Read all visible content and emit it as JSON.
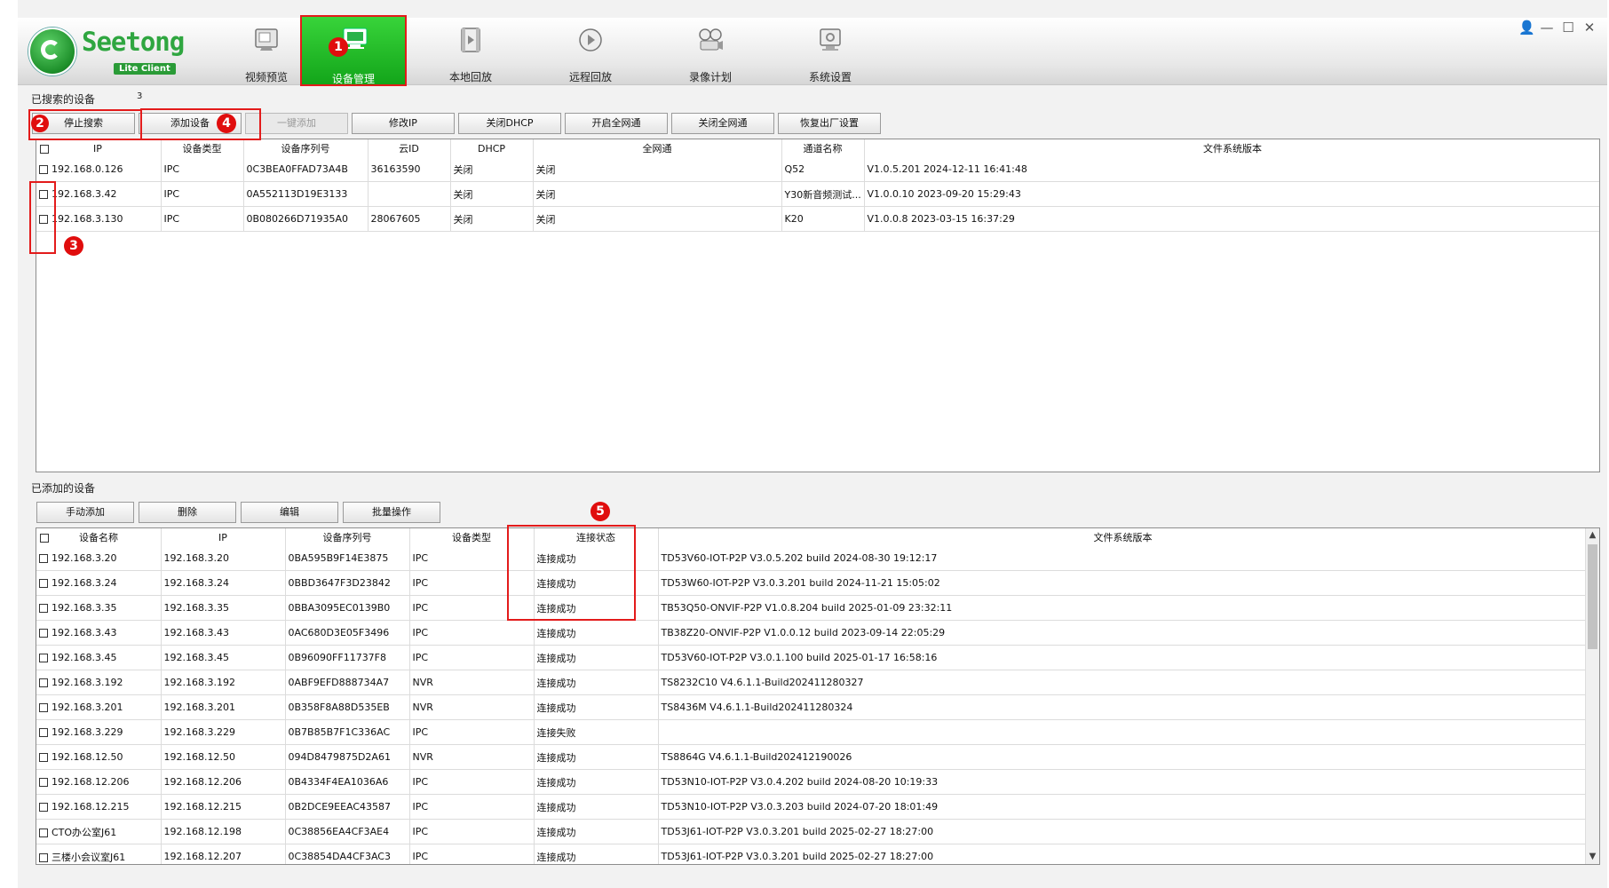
{
  "window": {
    "controls": [
      "👤",
      "—",
      "☐",
      "✕"
    ]
  },
  "logo": {
    "name": "Seetong",
    "subtitle": "Lite Client"
  },
  "nav": {
    "tabs": [
      {
        "label": "视频预览",
        "icon": "video-preview-icon"
      },
      {
        "label": "设备管理",
        "icon": "device-management-icon",
        "active": true
      },
      {
        "label": "本地回放",
        "icon": "local-playback-icon"
      },
      {
        "label": "远程回放",
        "icon": "remote-playback-icon"
      },
      {
        "label": "录像计划",
        "icon": "recording-plan-icon"
      },
      {
        "label": "系统设置",
        "icon": "system-settings-icon"
      }
    ]
  },
  "annotations": [
    "1",
    "2",
    "3",
    "4",
    "5"
  ],
  "searched": {
    "title": "已搜索的设备",
    "count": "3",
    "buttons": [
      "停止搜索",
      "添加设备",
      "一键添加",
      "修改IP",
      "关闭DHCP",
      "开启全网通",
      "关闭全网通",
      "恢复出厂设置"
    ],
    "columns": [
      "IP",
      "设备类型",
      "设备序列号",
      "云ID",
      "DHCP",
      "全网通",
      "通道名称",
      "文件系统版本"
    ],
    "rows": [
      [
        "192.168.0.126",
        "IPC",
        "0C3BEA0FFAD73A4B",
        "36163590",
        "关闭",
        "关闭",
        "Q52",
        "V1.0.5.201 2024-12-11 16:41:48"
      ],
      [
        "192.168.3.42",
        "IPC",
        "0A552113D19E3133",
        "",
        "关闭",
        "关闭",
        "Y30新音频测试...",
        "V1.0.0.10 2023-09-20 15:29:43"
      ],
      [
        "192.168.3.130",
        "IPC",
        "0B080266D71935A0",
        "28067605",
        "关闭",
        "关闭",
        "K20",
        "V1.0.0.8 2023-03-15 16:37:29"
      ]
    ]
  },
  "added": {
    "title": "已添加的设备",
    "buttons": [
      "手动添加",
      "删除",
      "编辑",
      "批量操作"
    ],
    "columns": [
      "设备名称",
      "IP",
      "设备序列号",
      "设备类型",
      "连接状态",
      "文件系统版本"
    ],
    "rows": [
      [
        "192.168.3.20",
        "192.168.3.20",
        "0BA595B9F14E3875",
        "IPC",
        "连接成功",
        "TD53V60-IOT-P2P V3.0.5.202 build 2024-08-30 19:12:17"
      ],
      [
        "192.168.3.24",
        "192.168.3.24",
        "0BBD3647F3D23842",
        "IPC",
        "连接成功",
        "TD53W60-IOT-P2P V3.0.3.201 build 2024-11-21 15:05:02"
      ],
      [
        "192.168.3.35",
        "192.168.3.35",
        "0BBA3095EC0139B0",
        "IPC",
        "连接成功",
        "TB53Q50-ONVIF-P2P V1.0.8.204 build 2025-01-09 23:32:11"
      ],
      [
        "192.168.3.43",
        "192.168.3.43",
        "0AC680D3E05F3496",
        "IPC",
        "连接成功",
        "TB38Z20-ONVIF-P2P V1.0.0.12 build 2023-09-14 22:05:29"
      ],
      [
        "192.168.3.45",
        "192.168.3.45",
        "0B96090FF11737F8",
        "IPC",
        "连接成功",
        "TD53V60-IOT-P2P V3.0.1.100 build 2025-01-17 16:58:16"
      ],
      [
        "192.168.3.192",
        "192.168.3.192",
        "0ABF9EFD888734A7",
        "NVR",
        "连接成功",
        "TS8232C10 V4.6.1.1-Build202411280327"
      ],
      [
        "192.168.3.201",
        "192.168.3.201",
        "0B358F8A88D535EB",
        "NVR",
        "连接成功",
        "TS8436M V4.6.1.1-Build202411280324"
      ],
      [
        "192.168.3.229",
        "192.168.3.229",
        "0B7B85B7F1C336AC",
        "IPC",
        "连接失败",
        ""
      ],
      [
        "192.168.12.50",
        "192.168.12.50",
        "094D8479875D2A61",
        "NVR",
        "连接成功",
        "TS8864G V4.6.1.1-Build202412190026"
      ],
      [
        "192.168.12.206",
        "192.168.12.206",
        "0B4334F4EA1036A6",
        "IPC",
        "连接成功",
        "TD53N10-IOT-P2P V3.0.4.202 build 2024-08-20 10:19:33"
      ],
      [
        "192.168.12.215",
        "192.168.12.215",
        "0B2DCE9EEAC43587",
        "IPC",
        "连接成功",
        "TD53N10-IOT-P2P V3.0.3.203 build 2024-07-20 18:01:49"
      ],
      [
        "CTO办公室J61",
        "192.168.12.198",
        "0C38856EA4CF3AE4",
        "IPC",
        "连接成功",
        "TD53J61-IOT-P2P V3.0.3.201 build 2025-02-27 18:27:00"
      ],
      [
        "三楼小会议室J61",
        "192.168.12.207",
        "0C38854DA4CF3AC3",
        "IPC",
        "连接成功",
        "TD53J61-IOT-P2P V3.0.3.201 build 2025-02-27 18:27:00"
      ]
    ]
  }
}
